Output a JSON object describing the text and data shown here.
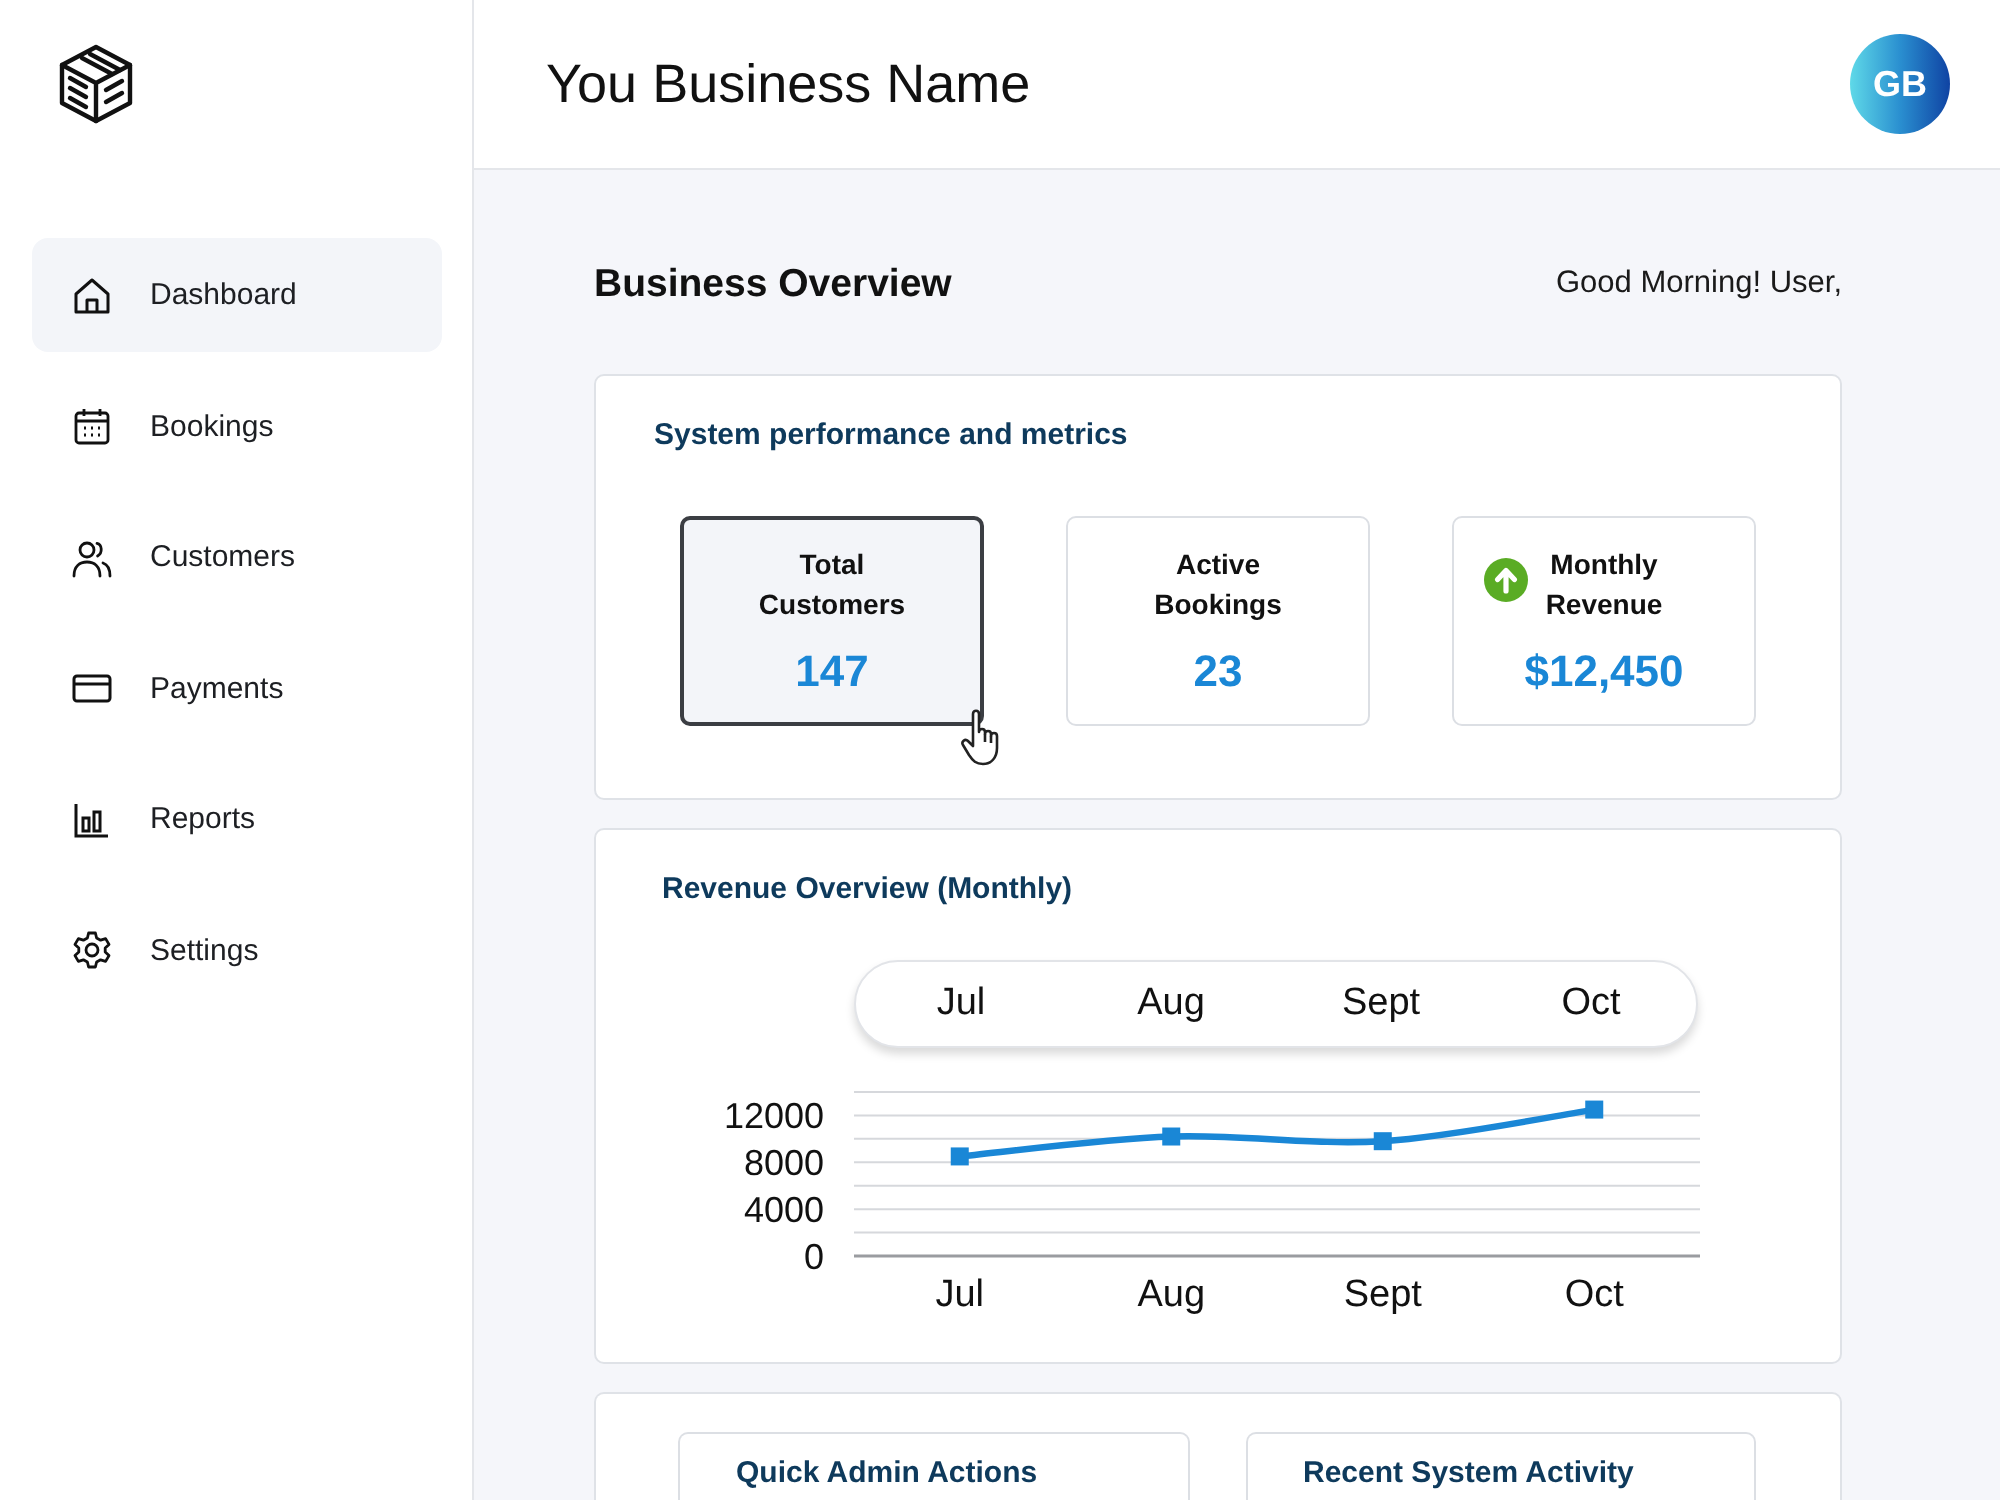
{
  "sidebar": {
    "items": [
      {
        "label": "Dashboard",
        "selected": true
      },
      {
        "label": "Bookings",
        "selected": false
      },
      {
        "label": "Customers",
        "selected": false
      },
      {
        "label": "Payments",
        "selected": false
      },
      {
        "label": "Reports",
        "selected": false
      },
      {
        "label": "Settings",
        "selected": false
      }
    ]
  },
  "header": {
    "title": "You Business Name",
    "avatar": "GB"
  },
  "overview": {
    "title": "Business Overview",
    "greeting": "Good Morning! User,"
  },
  "metrics": {
    "title": "System performance and metrics",
    "cards": [
      {
        "label": "Total Customers",
        "value": "147",
        "hovered": true,
        "trend_up": false
      },
      {
        "label": "Active Bookings",
        "value": "23",
        "hovered": false,
        "trend_up": false
      },
      {
        "label": "Monthly Revenue",
        "value": "$12,450",
        "hovered": false,
        "trend_up": true
      }
    ]
  },
  "revenue": {
    "month_filter": [
      "Jul",
      "Aug",
      "Sept",
      "Oct"
    ],
    "chart_data": {
      "type": "line",
      "title": "Revenue Overview (Monthly)",
      "categories": [
        "Jul",
        "Aug",
        "Sept",
        "Oct"
      ],
      "series": [
        {
          "color": "#1a87d6",
          "marker": "square",
          "values": [
            8500,
            10200,
            9800,
            12500
          ]
        }
      ],
      "ylim": [
        0,
        14000
      ],
      "yticks": [
        0,
        4000,
        8000,
        12000
      ],
      "grid": true
    }
  },
  "panels": [
    {
      "title": "Quick Admin Actions"
    },
    {
      "title": "Recent System Activity"
    }
  ]
}
